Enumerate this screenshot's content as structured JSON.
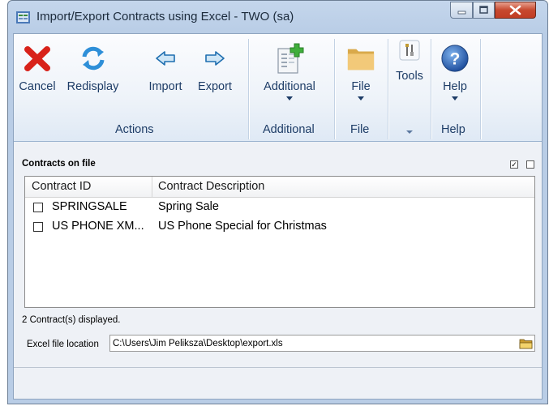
{
  "window": {
    "title": "Import/Export Contracts using Excel  -  TWO (sa)"
  },
  "ribbon": {
    "buttons": {
      "cancel": "Cancel",
      "redisplay": "Redisplay",
      "import": "Import",
      "export": "Export",
      "additional": "Additional",
      "file": "File",
      "tools": "Tools",
      "help": "Help"
    },
    "groups": {
      "actions": "Actions",
      "additional": "Additional",
      "file": "File",
      "help": "Help"
    }
  },
  "contracts": {
    "section_title": "Contracts on file",
    "mark_all_checked": "✓",
    "columns": [
      "Contract ID",
      "Contract Description"
    ],
    "rows": [
      {
        "id": "SPRINGSALE",
        "description": "Spring Sale",
        "checked": false
      },
      {
        "id": "US PHONE XM...",
        "description": "US Phone Special for Christmas",
        "checked": false
      }
    ],
    "count_text": "2 Contract(s) displayed."
  },
  "excel": {
    "label": "Excel file location",
    "value": "C:\\Users\\Jim Peliksza\\Desktop\\export.xls"
  },
  "colors": {
    "ribbon_text": "#1d3c66",
    "cancel_red": "#d8221a",
    "redisplay_blue": "#2e8fd8",
    "help_blue": "#2a63b8"
  }
}
